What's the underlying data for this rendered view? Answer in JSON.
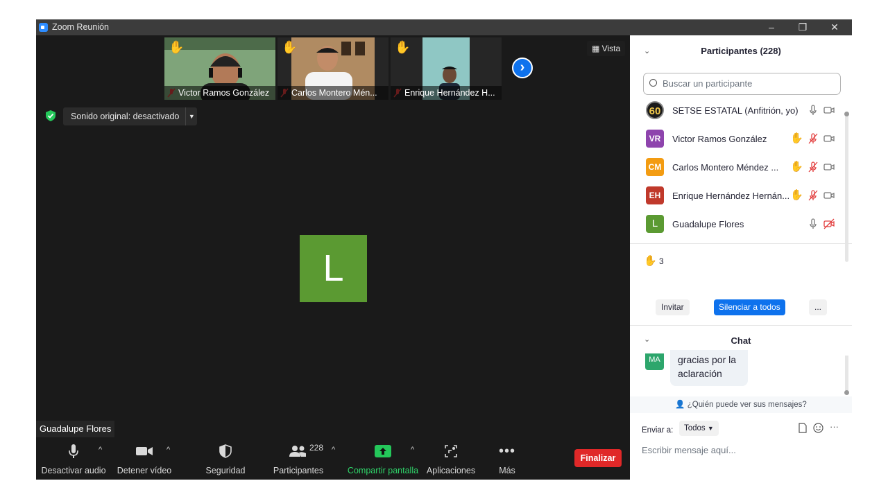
{
  "window": {
    "title": "Zoom Reunión",
    "controls": [
      "–",
      "❐",
      "✕"
    ]
  },
  "gallery": {
    "thumbnails": [
      {
        "name": "Victor Ramos González",
        "hand": "✋"
      },
      {
        "name": "Carlos Montero  Mén...",
        "hand": "✋"
      },
      {
        "name": "Enrique Hernández H...",
        "hand": "✋"
      }
    ],
    "next_arrow": "›",
    "view_label": "Vista"
  },
  "meeting": {
    "original_sound": "Sonido original: desactivado",
    "active_avatar_letter": "L",
    "active_avatar_color": "#5b9a32",
    "active_speaker_name": "Guadalupe Flores"
  },
  "toolbar": {
    "mute": "Desactivar audio",
    "stop_video": "Detener vídeo",
    "security": "Seguridad",
    "participants": "Participantes",
    "participants_count": "228",
    "share": "Compartir pantalla",
    "apps": "Aplicaciones",
    "more": "Más",
    "end": "Finalizar"
  },
  "participants_panel": {
    "title": "Participantes (228)",
    "search_placeholder": "Buscar un participante",
    "rows": [
      {
        "name": "SETSE ESTATAL (Anfitrión, yo)",
        "initials": "60",
        "color": "#1a1a1a",
        "hand": false,
        "mic": "on",
        "video": "on"
      },
      {
        "name": "Victor Ramos González",
        "initials": "VR",
        "color": "#8e44ad",
        "hand": true,
        "mic": "off",
        "video": "on"
      },
      {
        "name": "Carlos Montero  Méndez ...",
        "initials": "CM",
        "color": "#f39c12",
        "hand": true,
        "mic": "off",
        "video": "on"
      },
      {
        "name": "Enrique Hernández Hernán...",
        "initials": "EH",
        "color": "#c0392b",
        "hand": true,
        "mic": "off",
        "video": "on"
      },
      {
        "name": "Guadalupe Flores",
        "initials": "L",
        "color": "#5b9a32",
        "hand": false,
        "mic": "on",
        "video": "off"
      }
    ],
    "raised_hands_count": "3",
    "invite": "Invitar",
    "mute_all": "Silenciar a todos",
    "more": "..."
  },
  "chat": {
    "title": "Chat",
    "message_avatar": "MA",
    "message_avatar_color": "#2da66c",
    "message_text": "gracias por la aclaración",
    "who_can_see": "¿Quién puede ver sus mensajes?",
    "send_to_label": "Enviar a:",
    "recipient": "Todos",
    "compose_placeholder": "Escribir mensaje aquí..."
  }
}
